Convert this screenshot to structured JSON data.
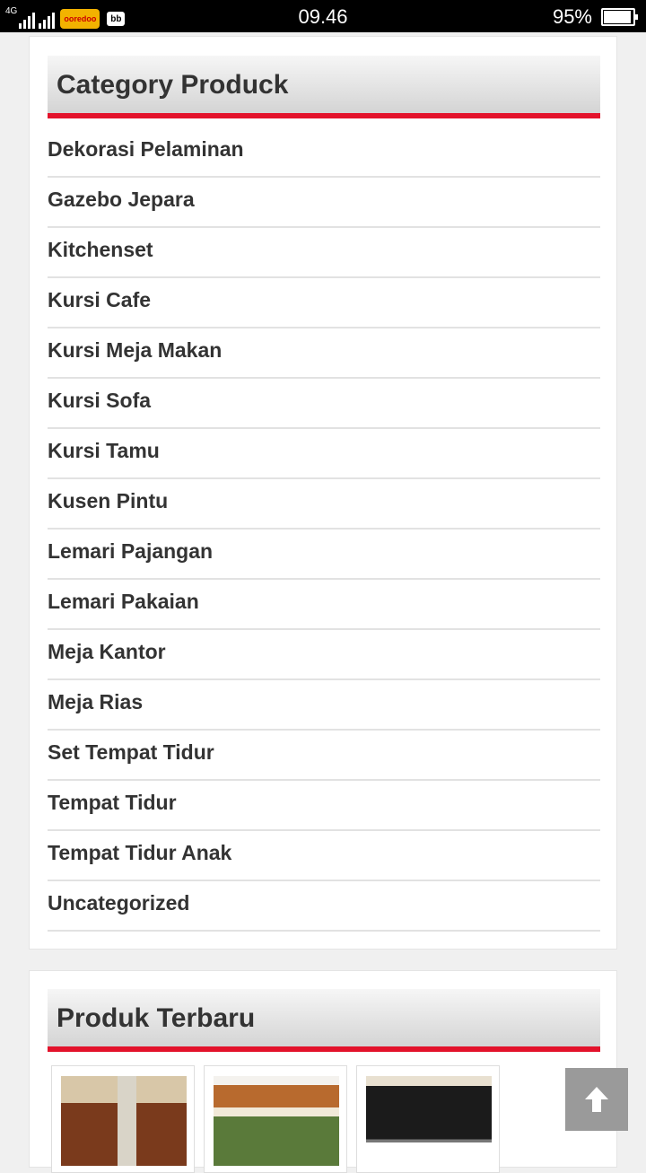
{
  "status_bar": {
    "network": "4G",
    "time": "09.46",
    "battery_percent": "95%",
    "battery_level": 0.95,
    "carrier_logo_text": "ooredoo"
  },
  "category_widget": {
    "title": "Category Produck",
    "items": [
      {
        "label": "Dekorasi Pelaminan"
      },
      {
        "label": "Gazebo Jepara"
      },
      {
        "label": "Kitchenset"
      },
      {
        "label": "Kursi Cafe"
      },
      {
        "label": "Kursi Meja Makan"
      },
      {
        "label": "Kursi Sofa"
      },
      {
        "label": "Kursi Tamu"
      },
      {
        "label": "Kusen Pintu"
      },
      {
        "label": "Lemari Pajangan"
      },
      {
        "label": "Lemari Pakaian"
      },
      {
        "label": "Meja Kantor"
      },
      {
        "label": "Meja Rias"
      },
      {
        "label": "Set Tempat Tidur"
      },
      {
        "label": "Tempat Tidur"
      },
      {
        "label": "Tempat Tidur Anak"
      },
      {
        "label": "Uncategorized"
      }
    ]
  },
  "latest_products_widget": {
    "title": "Produk Terbaru",
    "products": [
      {
        "image": "kitchen-set-photo"
      },
      {
        "image": "gazebo-photo"
      },
      {
        "image": "kids-bed-photo"
      }
    ]
  },
  "scroll_top_button": {
    "icon": "arrow-up-icon"
  },
  "colors": {
    "accent": "#e3122b",
    "text": "#333333",
    "background": "#f0f0f0"
  }
}
